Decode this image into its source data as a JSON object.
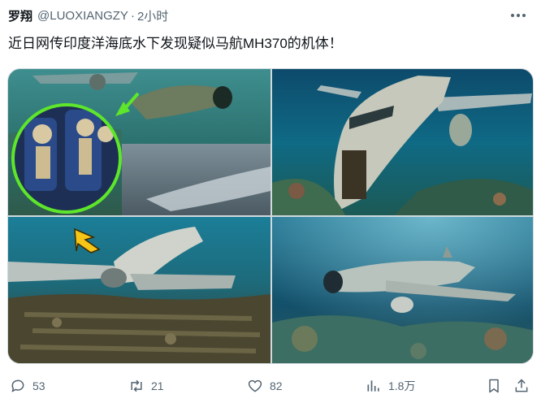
{
  "author": {
    "name": "罗翔",
    "handle": "@LUOXIANGZY",
    "separator": "·",
    "time": "2小时"
  },
  "post": {
    "text": "近日网传印度洋海底水下发现疑似马航MH370的机体！"
  },
  "media": {
    "images": [
      {
        "id": "underwater-plane-wreck-with-skeleton-inset"
      },
      {
        "id": "rusted-airliner-on-seabed"
      },
      {
        "id": "broken-airliner-wreck-with-yellow-arrow"
      },
      {
        "id": "propeller-plane-wreck-on-reef"
      }
    ]
  },
  "actions": {
    "replies": "53",
    "retweets": "21",
    "likes": "82",
    "views": "1.8万"
  },
  "colors": {
    "text_primary": "#0f1419",
    "text_secondary": "#536471",
    "border": "#cfd9de",
    "inset_ring": "#5ee62b",
    "annotation_arrow": "#f5c518"
  },
  "icons": [
    "more-icon",
    "reply-icon",
    "retweet-icon",
    "like-icon",
    "views-icon",
    "bookmark-icon",
    "share-icon"
  ]
}
